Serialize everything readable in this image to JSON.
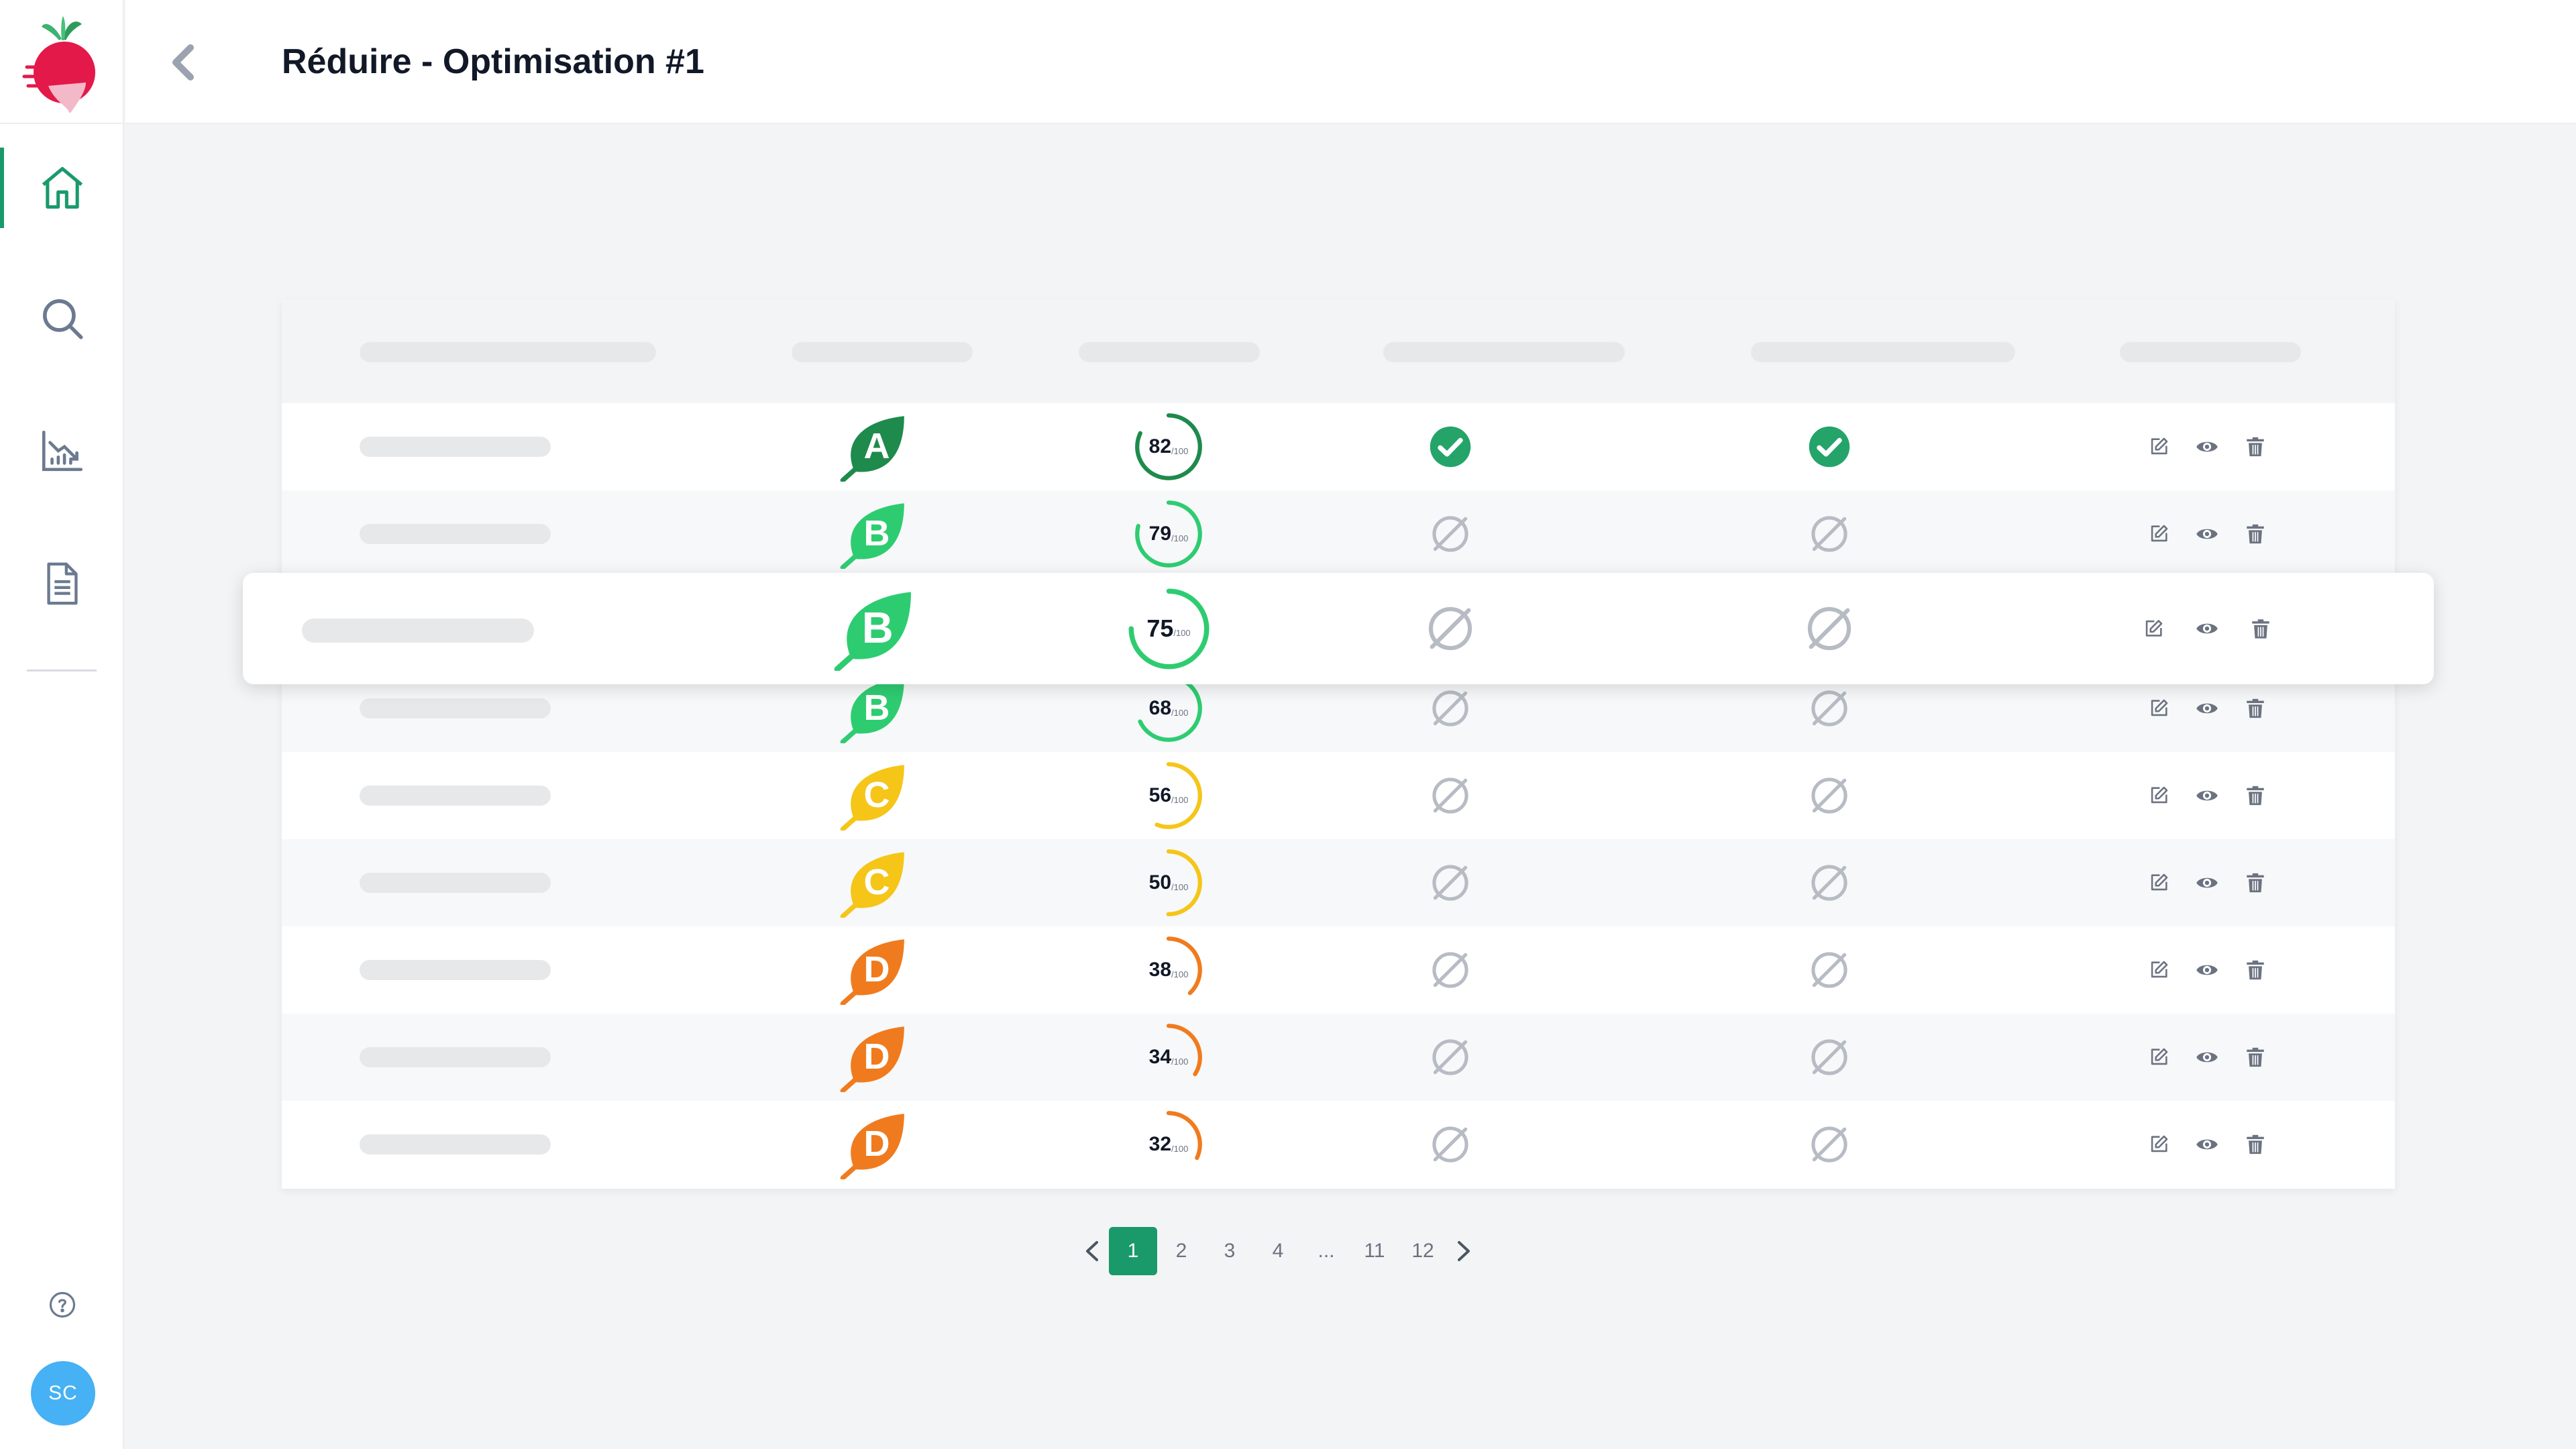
{
  "header": {
    "title": "Réduire - Optimisation #1"
  },
  "sidebar": {
    "items": [
      {
        "name": "home",
        "active": true
      },
      {
        "name": "search",
        "active": false
      },
      {
        "name": "analytics",
        "active": false
      },
      {
        "name": "document",
        "active": false
      }
    ],
    "avatar_initials": "SC"
  },
  "colors": {
    "accent": "#1a9a6b",
    "grade_A": "#1e8a4c",
    "grade_B": "#2ecc71",
    "grade_C": "#f5c518",
    "grade_D": "#f07b1e",
    "check": "#24a469",
    "icon_grey": "#6b7280",
    "avatar": "#46b1f4"
  },
  "table": {
    "rows": [
      {
        "grade": "A",
        "score": "82",
        "score_suffix": "/100",
        "check1": true,
        "check2": true
      },
      {
        "grade": "B",
        "score": "79",
        "score_suffix": "/100",
        "check1": false,
        "check2": false
      },
      {
        "grade": "B",
        "score": "75",
        "score_suffix": "/100",
        "check1": false,
        "check2": false,
        "highlighted": true
      },
      {
        "grade": "B",
        "score": "68",
        "score_suffix": "/100",
        "check1": false,
        "check2": false
      },
      {
        "grade": "C",
        "score": "56",
        "score_suffix": "/100",
        "check1": false,
        "check2": false
      },
      {
        "grade": "C",
        "score": "50",
        "score_suffix": "/100",
        "check1": false,
        "check2": false
      },
      {
        "grade": "D",
        "score": "38",
        "score_suffix": "/100",
        "check1": false,
        "check2": false
      },
      {
        "grade": "D",
        "score": "34",
        "score_suffix": "/100",
        "check1": false,
        "check2": false
      },
      {
        "grade": "D",
        "score": "32",
        "score_suffix": "/100",
        "check1": false,
        "check2": false
      }
    ],
    "action_icons": [
      "edit-icon",
      "eye-icon",
      "trash-icon"
    ]
  },
  "pagination": {
    "pages": [
      "1",
      "2",
      "3",
      "4",
      "...",
      "11",
      "12"
    ],
    "current": "1"
  }
}
